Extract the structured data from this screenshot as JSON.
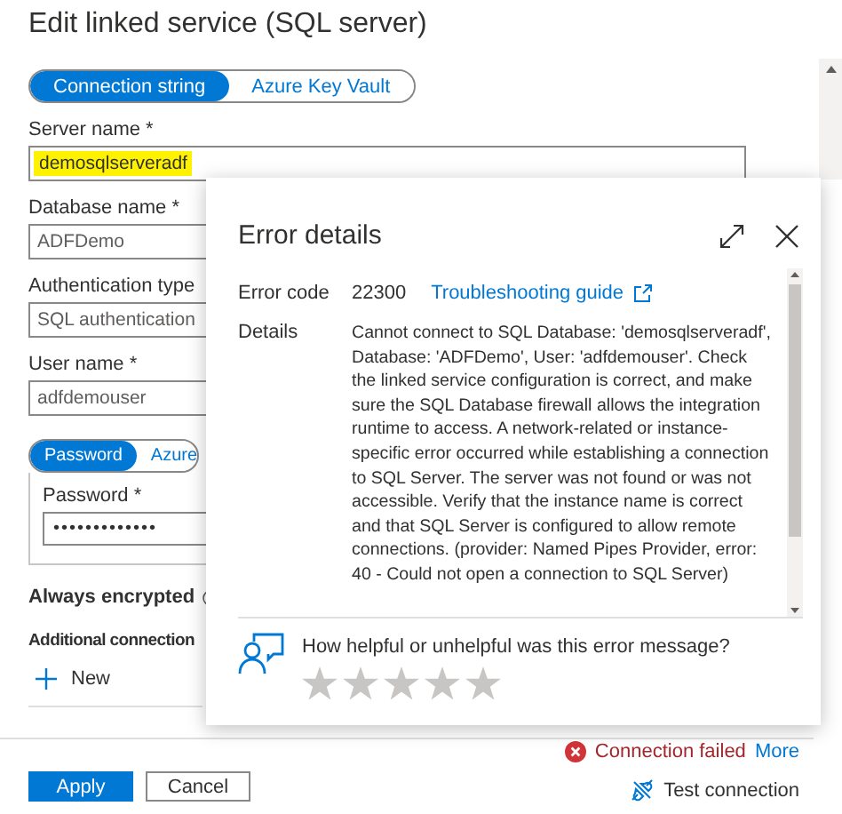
{
  "title": "Edit linked service (SQL server)",
  "source_tabs": [
    {
      "label": "Connection string",
      "selected": true
    },
    {
      "label": "Azure Key Vault",
      "selected": false
    }
  ],
  "fields": [
    {
      "label": "Server name *",
      "value": "demosqlserveradf",
      "highlighted": true
    },
    {
      "label": "Database name *",
      "value": "ADFDemo",
      "highlighted": false
    },
    {
      "label": "Authentication type",
      "value": "SQL authentication",
      "highlighted": false
    },
    {
      "label": "User name *",
      "value": "adfdemouser",
      "highlighted": false
    }
  ],
  "password_tabs": [
    {
      "label": "Password",
      "selected": true
    },
    {
      "label": "Azure",
      "selected": false
    }
  ],
  "password": {
    "label": "Password *",
    "value": "•••••••••••••"
  },
  "always_encrypted": "Always encrypted",
  "additional_connection": "Additional connection",
  "new_button": "New",
  "buttons": [
    {
      "label": "Apply",
      "kind": "primary"
    },
    {
      "label": "Cancel",
      "kind": "secondary"
    }
  ],
  "status": {
    "text": "Connection failed",
    "link": "More"
  },
  "test_connection": "Test connection",
  "dialog": {
    "title": "Error details",
    "error_code_label": "Error code",
    "error_code": "22300",
    "link": "Troubleshooting guide",
    "details_label": "Details",
    "details": "Cannot connect to SQL Database: 'demosqlserveradf', Database: 'ADFDemo', User: 'adfdemouser'. Check the linked service configuration is correct, and make sure the SQL Database firewall allows the integration runtime to access. A network-related or instance-specific error occurred while establishing a connection to SQL Server. The server was not found or was not accessible. Verify that the instance name is correct and that SQL Server is configured to allow remote connections. (provider: Named Pipes Provider, error: 40 - Could not open a connection to SQL Server)",
    "feedback_question": "How helpful or unhelpful was this error message?",
    "stars": 0
  }
}
